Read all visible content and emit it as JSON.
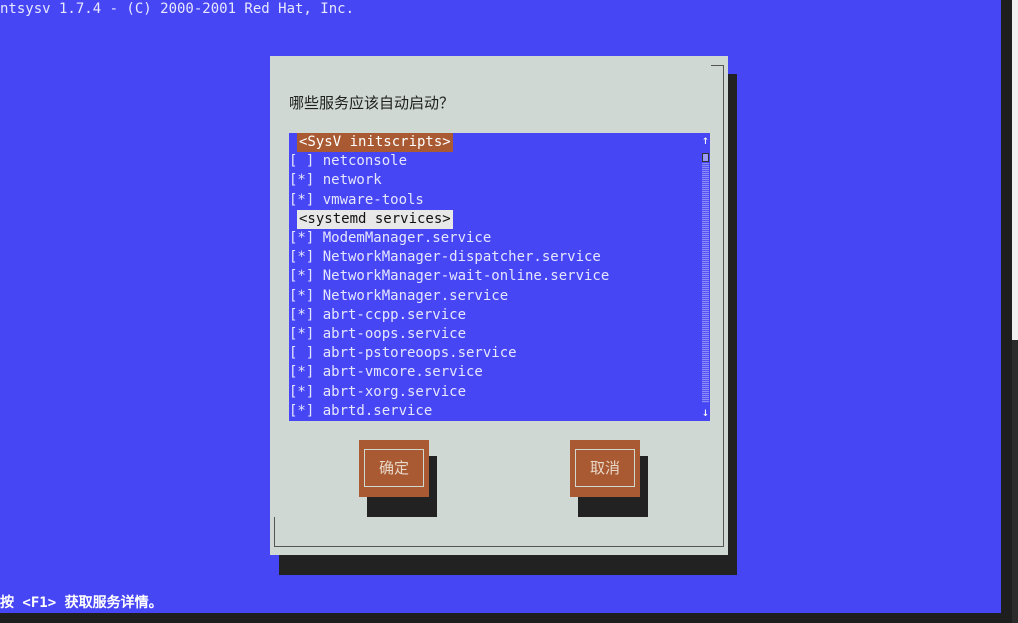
{
  "app": {
    "title_line": "ntsysv 1.7.4 - (C) 2000-2001 Red Hat, Inc.",
    "hint_line": "按 <F1> 获取服务详情。"
  },
  "dialog": {
    "question": "哪些服务应该自动启动？",
    "list": [
      {
        "type": "header",
        "label": "<SysV initscripts>",
        "active": true
      },
      {
        "type": "item",
        "checked": false,
        "text": "[ ] netconsole"
      },
      {
        "type": "item",
        "checked": true,
        "text": "[*] network"
      },
      {
        "type": "item",
        "checked": true,
        "text": "[*] vmware-tools"
      },
      {
        "type": "header",
        "label": "<systemd services>",
        "active": false
      },
      {
        "type": "item",
        "checked": true,
        "text": "[*] ModemManager.service"
      },
      {
        "type": "item",
        "checked": true,
        "text": "[*] NetworkManager-dispatcher.service"
      },
      {
        "type": "item",
        "checked": true,
        "text": "[*] NetworkManager-wait-online.service"
      },
      {
        "type": "item",
        "checked": true,
        "text": "[*] NetworkManager.service"
      },
      {
        "type": "item",
        "checked": true,
        "text": "[*] abrt-ccpp.service"
      },
      {
        "type": "item",
        "checked": true,
        "text": "[*] abrt-oops.service"
      },
      {
        "type": "item",
        "checked": false,
        "text": "[ ] abrt-pstoreoops.service"
      },
      {
        "type": "item",
        "checked": true,
        "text": "[*] abrt-vmcore.service"
      },
      {
        "type": "item",
        "checked": true,
        "text": "[*] abrt-xorg.service"
      },
      {
        "type": "item",
        "checked": true,
        "text": "[*] abrtd.service"
      }
    ],
    "scroll": {
      "up_arrow": "↑",
      "down_arrow": "↓"
    },
    "ok_label": "确定",
    "cancel_label": "取消"
  },
  "colors": {
    "terminal_bg": "#4646f5",
    "dialog_bg": "#cfd8d2",
    "button_bg": "#a95a33"
  }
}
